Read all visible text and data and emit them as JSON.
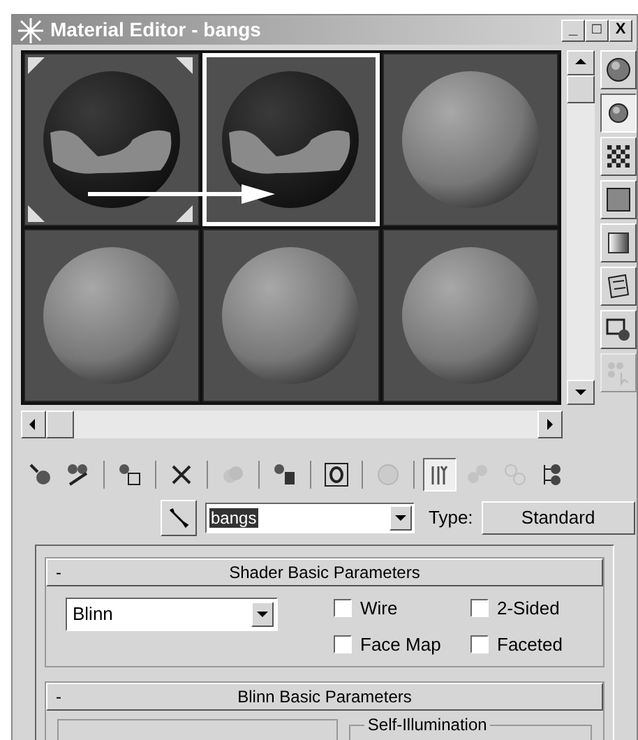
{
  "window": {
    "title": "Material Editor - bangs",
    "controls": [
      "_",
      "□",
      "X"
    ]
  },
  "slots": [
    {
      "kind": "texture",
      "selected": false,
      "active": true
    },
    {
      "kind": "texture",
      "selected": true,
      "active": false
    },
    {
      "kind": "plain",
      "selected": false,
      "active": false
    },
    {
      "kind": "plain",
      "selected": false,
      "active": false
    },
    {
      "kind": "plain",
      "selected": false,
      "active": false
    },
    {
      "kind": "plain",
      "selected": false,
      "active": false
    }
  ],
  "side_tools": [
    {
      "kind": "sphere",
      "pressed": false
    },
    {
      "kind": "sphere-small",
      "pressed": true
    },
    {
      "kind": "checker",
      "pressed": false
    },
    {
      "kind": "square",
      "pressed": false
    },
    {
      "kind": "gradient",
      "pressed": false
    },
    {
      "kind": "film",
      "pressed": false
    },
    {
      "kind": "cube-sphere",
      "pressed": false
    },
    {
      "kind": "select",
      "pressed": false,
      "disabled": true
    }
  ],
  "toolbar": [
    {
      "kind": "get",
      "disabled": false,
      "pressed": false
    },
    {
      "kind": "put",
      "disabled": false,
      "pressed": false
    },
    {
      "kind": "sep"
    },
    {
      "kind": "copy",
      "disabled": false,
      "pressed": false
    },
    {
      "kind": "sep"
    },
    {
      "kind": "delete",
      "disabled": false,
      "pressed": false
    },
    {
      "kind": "sep"
    },
    {
      "kind": "unique",
      "disabled": true,
      "pressed": false
    },
    {
      "kind": "sep"
    },
    {
      "kind": "save",
      "disabled": false,
      "pressed": false
    },
    {
      "kind": "sep"
    },
    {
      "kind": "channel",
      "disabled": false,
      "pressed": false
    },
    {
      "kind": "sep"
    },
    {
      "kind": "show",
      "disabled": true,
      "pressed": false
    },
    {
      "kind": "sep"
    },
    {
      "kind": "end",
      "disabled": false,
      "pressed": true
    },
    {
      "kind": "parent",
      "disabled": true,
      "pressed": false
    },
    {
      "kind": "sibling",
      "disabled": true,
      "pressed": false
    },
    {
      "kind": "navigator",
      "disabled": false,
      "pressed": false
    }
  ],
  "name_field": {
    "value": "bangs",
    "type_label": "Type:",
    "type_button": "Standard"
  },
  "shader_rollout": {
    "sign": "-",
    "title": "Shader Basic Parameters",
    "shader": "Blinn",
    "options": [
      {
        "label": "Wire",
        "checked": false
      },
      {
        "label": "2-Sided",
        "checked": false
      },
      {
        "label": "Face Map",
        "checked": false
      },
      {
        "label": "Faceted",
        "checked": false
      }
    ]
  },
  "blinn_rollout": {
    "sign": "-",
    "title": "Blinn Basic Parameters",
    "group": "Self-Illumination"
  }
}
